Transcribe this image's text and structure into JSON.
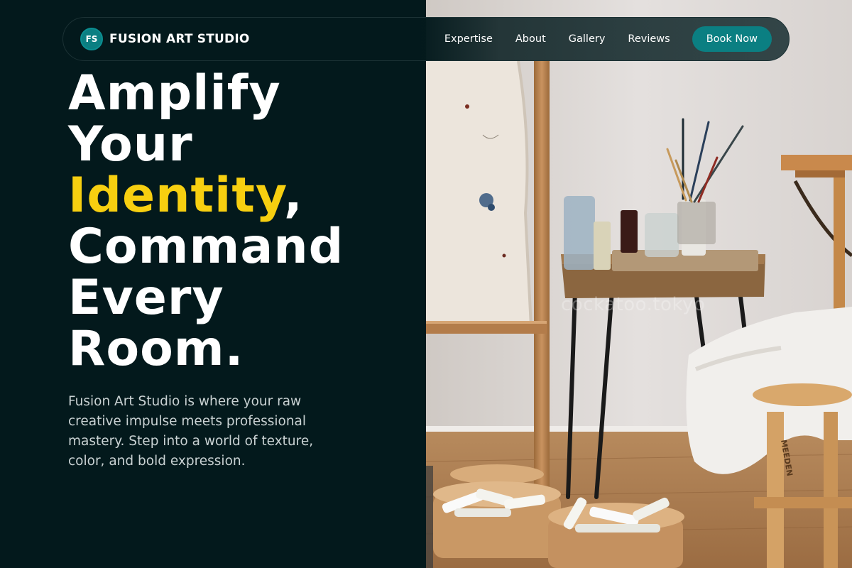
{
  "nav": {
    "logo_badge": "FS",
    "brand": "FUSION ART STUDIO",
    "links": [
      "Expertise",
      "About",
      "Gallery",
      "Reviews"
    ],
    "cta": "Book Now"
  },
  "hero": {
    "line1": "Amplify",
    "line2": "Your",
    "accent_word": "Identity",
    "comma": ",",
    "line4": "Command",
    "line5": "Every",
    "line6": "Room.",
    "subtitle": "Fusion Art Studio is where your raw creative impulse meets professional mastery. Step into a world of texture, color, and bold expression."
  },
  "photo": {
    "watermark": "cockatoo.tokyo",
    "stool_text": "MEEDEN"
  },
  "colors": {
    "background": "#03191c",
    "accent_yellow": "#f7cf10",
    "teal": "#0b7f82",
    "subtitle_text": "#c9d2d3"
  }
}
